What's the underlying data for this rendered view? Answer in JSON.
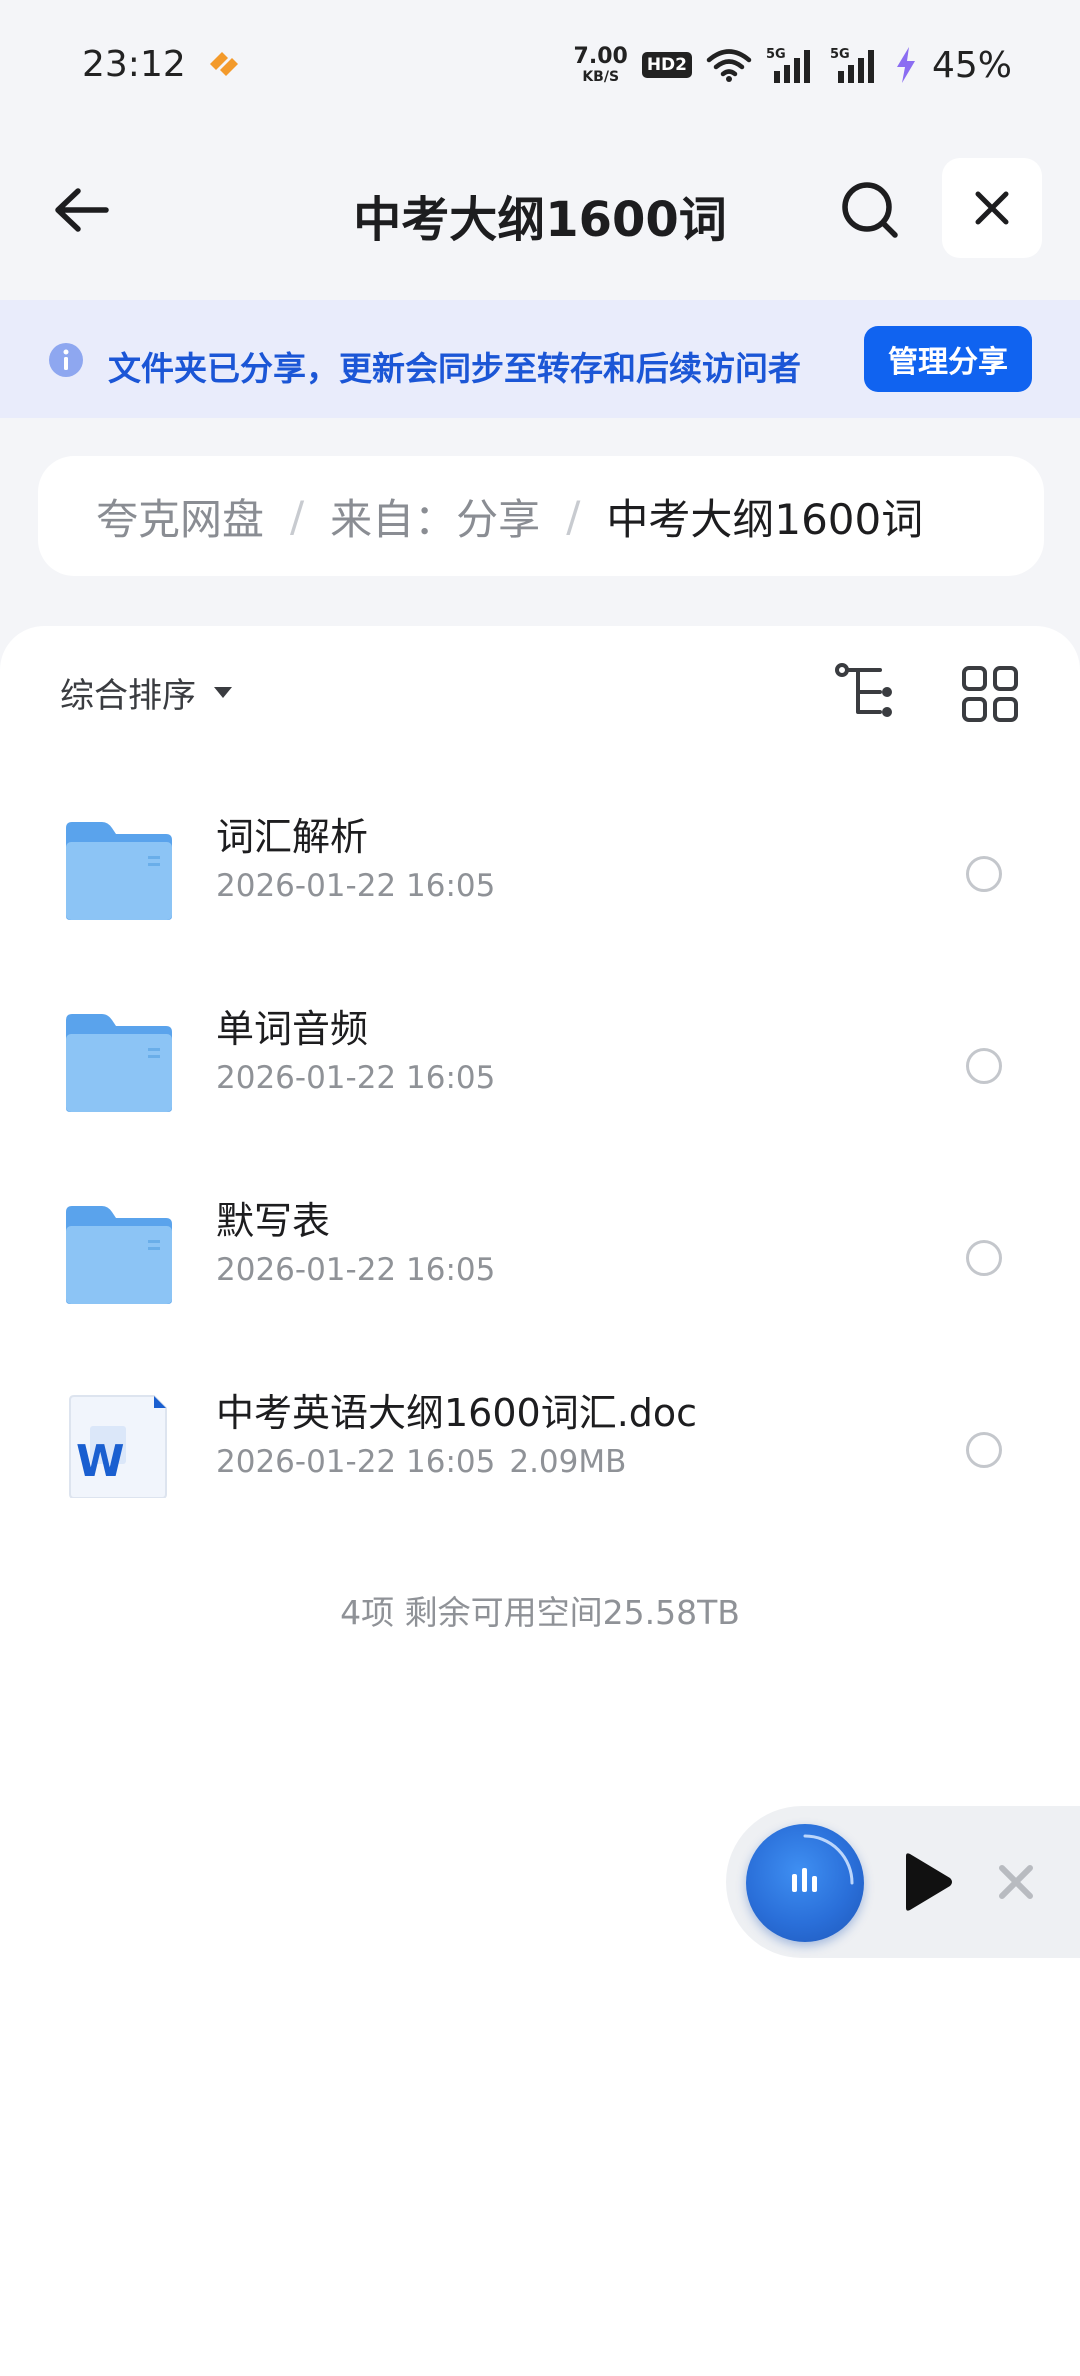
{
  "status_bar": {
    "time": "23:12",
    "net_speed_value": "7.00",
    "net_speed_unit": "KB/S",
    "hd_badge": "HD2",
    "signal_1": "5G",
    "signal_2": "5G",
    "battery": "45%"
  },
  "header": {
    "title": "中考大纲1600词"
  },
  "banner": {
    "text": "文件夹已分享，更新会同步至转存和后续访问者",
    "button_label": "管理分享"
  },
  "breadcrumb": {
    "items": [
      "夸克网盘",
      "来自：分享"
    ],
    "current": "中考大纲1600词",
    "separator": "/"
  },
  "toolbar": {
    "sort_label": "综合排序"
  },
  "files": [
    {
      "name": "词汇解析",
      "date": "2026-01-22 16:05",
      "size": "",
      "type": "folder"
    },
    {
      "name": "单词音频",
      "date": "2026-01-22 16:05",
      "size": "",
      "type": "folder"
    },
    {
      "name": "默写表",
      "date": "2026-01-22 16:05",
      "size": "",
      "type": "folder"
    },
    {
      "name": "中考英语大纲1600词汇.doc",
      "date": "2026-01-22 16:05",
      "size": "2.09MB",
      "type": "word-doc"
    }
  ],
  "summary": "4项 剩余可用空间25.58TB",
  "colors": {
    "accent": "#1063f0",
    "banner_bg": "#e9ecfb",
    "banner_text": "#1b56d6",
    "folder": "#7cb8f2",
    "page_bg": "#f4f5f8"
  },
  "icons": {
    "back": "arrow-left-icon",
    "search": "search-icon",
    "close": "close-icon",
    "info": "info-icon",
    "tree_view": "tree-view-icon",
    "grid_view": "grid-view-icon",
    "folder": "folder-icon",
    "word": "word-doc-icon",
    "play": "play-icon"
  }
}
